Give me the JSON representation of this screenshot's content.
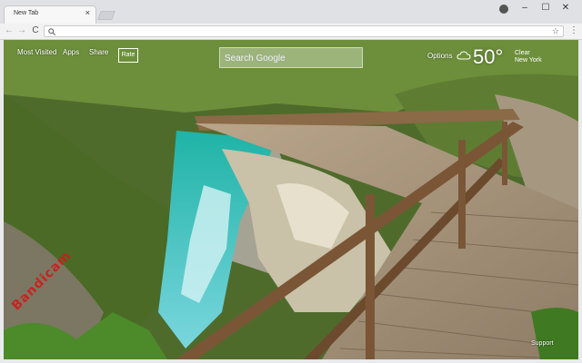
{
  "browser": {
    "tab_title": "New Tab",
    "tab_close": "×",
    "address_value": "",
    "controls": {
      "minimize": "–",
      "maximize": "☐",
      "close": "✕"
    },
    "nav": {
      "back": "←",
      "forward": "→",
      "reload": "C"
    },
    "star": "☆",
    "menu": "⋮"
  },
  "newtab": {
    "links": [
      "Most Visited",
      "Apps",
      "Share"
    ],
    "rate_label": "Rate",
    "search_placeholder": "Search Google",
    "options_label": "Options",
    "weather": {
      "temp": "50°",
      "condition": "Clear",
      "location": "New York"
    },
    "support_label": "Support",
    "stamp": "Bandicam"
  },
  "icons": {
    "search": "search-icon",
    "profile": "profile-icon",
    "weather": "cloud-icon"
  }
}
